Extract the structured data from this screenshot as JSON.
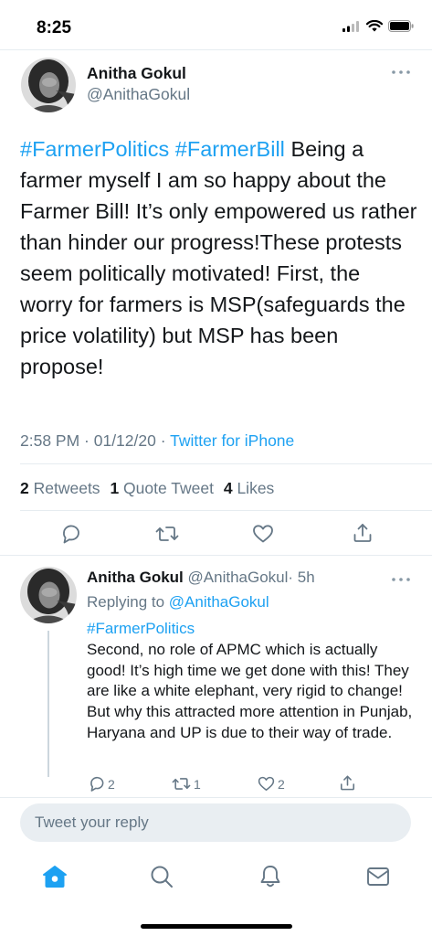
{
  "status": {
    "time": "8:25"
  },
  "main_tweet": {
    "author_name": "Anitha Gokul",
    "author_handle": "@AnithaGokul",
    "hashtag1": "#FarmerPolitics",
    "hashtag2": "#FarmerBill",
    "body": "Being a farmer myself I am so happy about the Farmer Bill! It’s only empowered us rather than hinder our progress!These protests seem politically motivated! First, the worry for farmers is MSP(safeguards the price volatility) but MSP has been propose!",
    "timestamp": "2:58 PM · 01/12/20 · ",
    "source": "Twitter for iPhone",
    "retweets_count": "2",
    "retweets_label": "Retweets",
    "quotes_count": "1",
    "quotes_label": "Quote Tweet",
    "likes_count": "4",
    "likes_label": "Likes"
  },
  "reply_tweet": {
    "author_name": "Anitha Gokul",
    "author_handle": "@AnithaGokul",
    "time_ago": "· 5h",
    "replying_label": "Replying to",
    "replying_handle": "@AnithaGokul",
    "hashtag": "#FarmerPolitics",
    "body": "Second, no role of APMC which is actually good! It’s high time we get done with this! They are like a white elephant, very rigid to change! But why this attracted more attention in Punjab, Haryana and UP is due to their way of trade.",
    "reply_count": "2",
    "retweet_count": "1",
    "like_count": "2"
  },
  "reply_input": {
    "placeholder": "Tweet your reply"
  },
  "colors": {
    "accent": "#1da1f2",
    "muted": "#657786",
    "divider": "#e6ecf0"
  },
  "icons": [
    "more-icon",
    "reply-icon",
    "retweet-icon",
    "like-icon",
    "share-icon",
    "home-icon",
    "search-icon",
    "notifications-icon",
    "messages-icon"
  ]
}
